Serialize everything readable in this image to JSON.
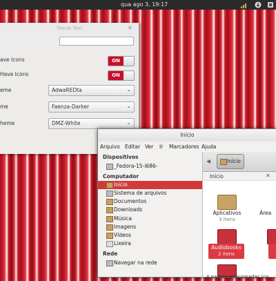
{
  "topbar": {
    "clock": "qua ago 3, 19:17"
  },
  "tweak_tool": {
    "title": "Tweak Tool",
    "rows": [
      {
        "label": "ave Icons",
        "toggle": "ON"
      },
      {
        "label": "Have Icons",
        "toggle": "ON"
      }
    ],
    "combos": [
      {
        "label": "eme",
        "value": "AdwaREDta"
      },
      {
        "label": "me",
        "value": "Faenza-Darker"
      },
      {
        "label": "heme",
        "value": "DMZ-White"
      }
    ]
  },
  "nautilus": {
    "title": "Início",
    "menu": [
      "Arquivo",
      "Editar",
      "Ver",
      "Ir",
      "Marcadores",
      "Ajuda"
    ],
    "sidebar": {
      "devices_header": "Dispositivos",
      "devices": [
        {
          "label": "_Fedora-15-i686-",
          "icon": "drive-icon"
        }
      ],
      "computer_header": "Computador",
      "computer": [
        {
          "label": "Início",
          "icon": "home-folder-icon",
          "selected": true
        },
        {
          "label": "Sistema de arquivos",
          "icon": "folder-icon"
        },
        {
          "label": "Documentos",
          "icon": "folder-icon"
        },
        {
          "label": "Downloads",
          "icon": "folder-icon"
        },
        {
          "label": "Música",
          "icon": "folder-icon"
        },
        {
          "label": "Imagens",
          "icon": "folder-icon"
        },
        {
          "label": "Vídeos",
          "icon": "folder-icon"
        },
        {
          "label": "Lixeira",
          "icon": "trash-icon"
        }
      ],
      "network_header": "Rede",
      "network": [
        {
          "label": "Navegar na rede",
          "icon": "network-icon"
        }
      ]
    },
    "path_button": "Início",
    "location_header": "Início",
    "folders": [
      {
        "name": "Aplicativos",
        "sub": "3 itens",
        "selected": false
      },
      {
        "name": "Área",
        "sub": "",
        "selected": false
      },
      {
        "name": "Audiobooks",
        "sub": "2 itens",
        "selected": true
      }
    ],
    "status": "4 pastas selecionadas (co"
  }
}
